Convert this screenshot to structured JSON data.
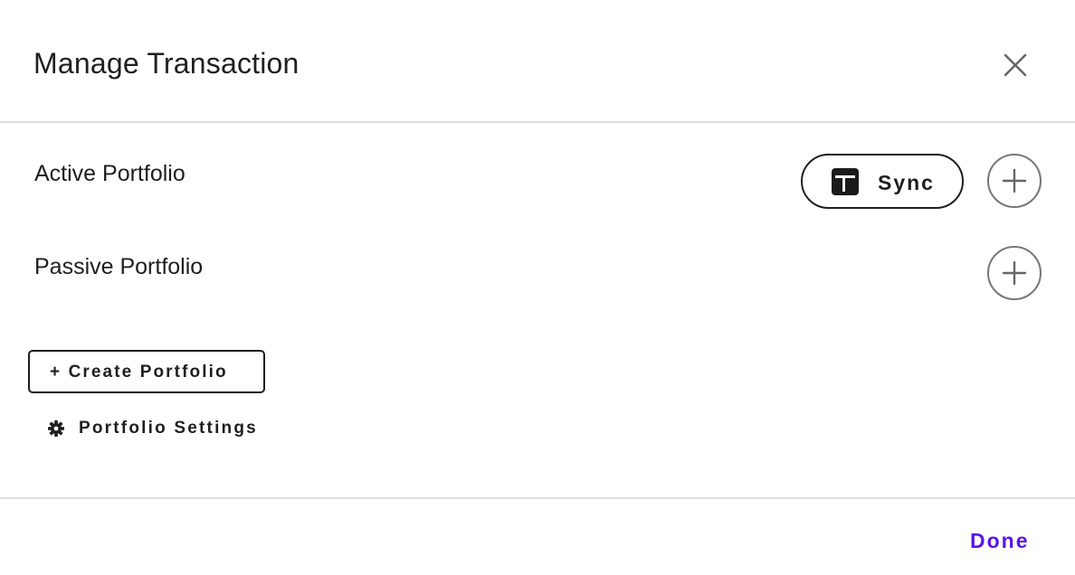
{
  "dialog": {
    "title": "Manage Transaction",
    "close_icon": "close-icon"
  },
  "portfolios": {
    "active": {
      "label": "Active Portfolio",
      "sync_label": "Sync",
      "sync_icon": "sync-brand-icon",
      "add_icon": "plus-icon"
    },
    "passive": {
      "label": "Passive Portfolio",
      "add_icon": "plus-icon"
    }
  },
  "actions": {
    "create_label": "+ Create Portfolio",
    "settings_label": "Portfolio Settings",
    "settings_icon": "gear-icon"
  },
  "footer": {
    "done_label": "Done"
  },
  "colors": {
    "accent": "#5b13e8",
    "text": "#1f1f1f",
    "divider": "#dcdcdc",
    "circle_border": "#777777"
  }
}
